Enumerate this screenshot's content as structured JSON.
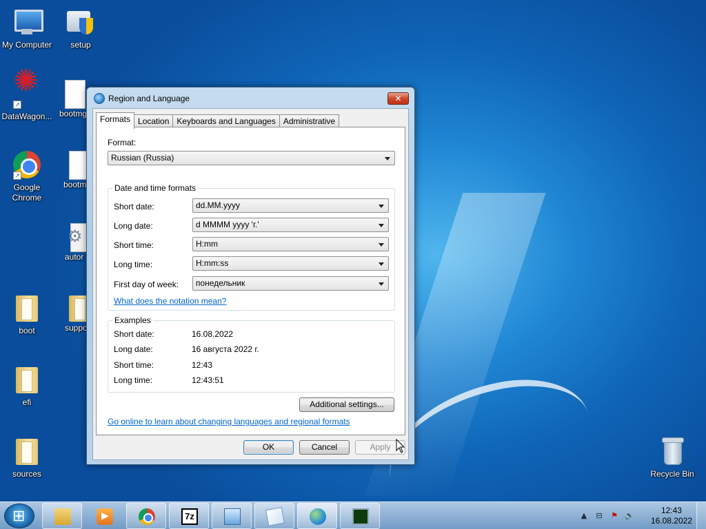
{
  "desktop": {
    "icons": [
      {
        "label": "My Computer"
      },
      {
        "label": "setup"
      },
      {
        "label": "DataWagon..."
      },
      {
        "label": "bootmg"
      },
      {
        "label": "Google Chrome"
      },
      {
        "label": "bootm"
      },
      {
        "label": "autor"
      },
      {
        "label": "boot"
      },
      {
        "label": "suppo"
      },
      {
        "label": "efi"
      },
      {
        "label": "sources"
      },
      {
        "label": "Recycle Bin"
      }
    ]
  },
  "dialog": {
    "title": "Region and Language",
    "close_label": "✕",
    "tabs": [
      {
        "label": "Formats"
      },
      {
        "label": "Location"
      },
      {
        "label": "Keyboards and Languages"
      },
      {
        "label": "Administrative"
      }
    ],
    "format_label": "Format:",
    "format_value": "Russian (Russia)",
    "datetime_group_title": "Date and time formats",
    "datetime_fields": [
      {
        "label": "Short date:",
        "value": "dd.MM.yyyy"
      },
      {
        "label": "Long date:",
        "value": "d MMMM yyyy 'г.'"
      },
      {
        "label": "Short time:",
        "value": "H:mm"
      },
      {
        "label": "Long time:",
        "value": "H:mm:ss"
      },
      {
        "label": "First day of week:",
        "value": "понедельник"
      }
    ],
    "notation_link": "What does the notation mean?",
    "examples_group_title": "Examples",
    "examples": [
      {
        "label": "Short date:",
        "value": "16.08.2022"
      },
      {
        "label": "Long date:",
        "value": "16 августа 2022 г."
      },
      {
        "label": "Short time:",
        "value": "12:43"
      },
      {
        "label": "Long time:",
        "value": "12:43:51"
      }
    ],
    "additional_settings_label": "Additional settings...",
    "online_link": "Go online to learn about changing languages and regional formats",
    "ok_label": "OK",
    "cancel_label": "Cancel",
    "apply_label": "Apply"
  },
  "taskbar": {
    "items": [
      "explorer-icon",
      "media-player-icon",
      "chrome-icon",
      "7zip-icon",
      "control-panel-icon",
      "notepad-icon",
      "globe-icon",
      "monitor-icon"
    ],
    "clock_time": "12:43",
    "clock_date": "16.08.2022"
  }
}
